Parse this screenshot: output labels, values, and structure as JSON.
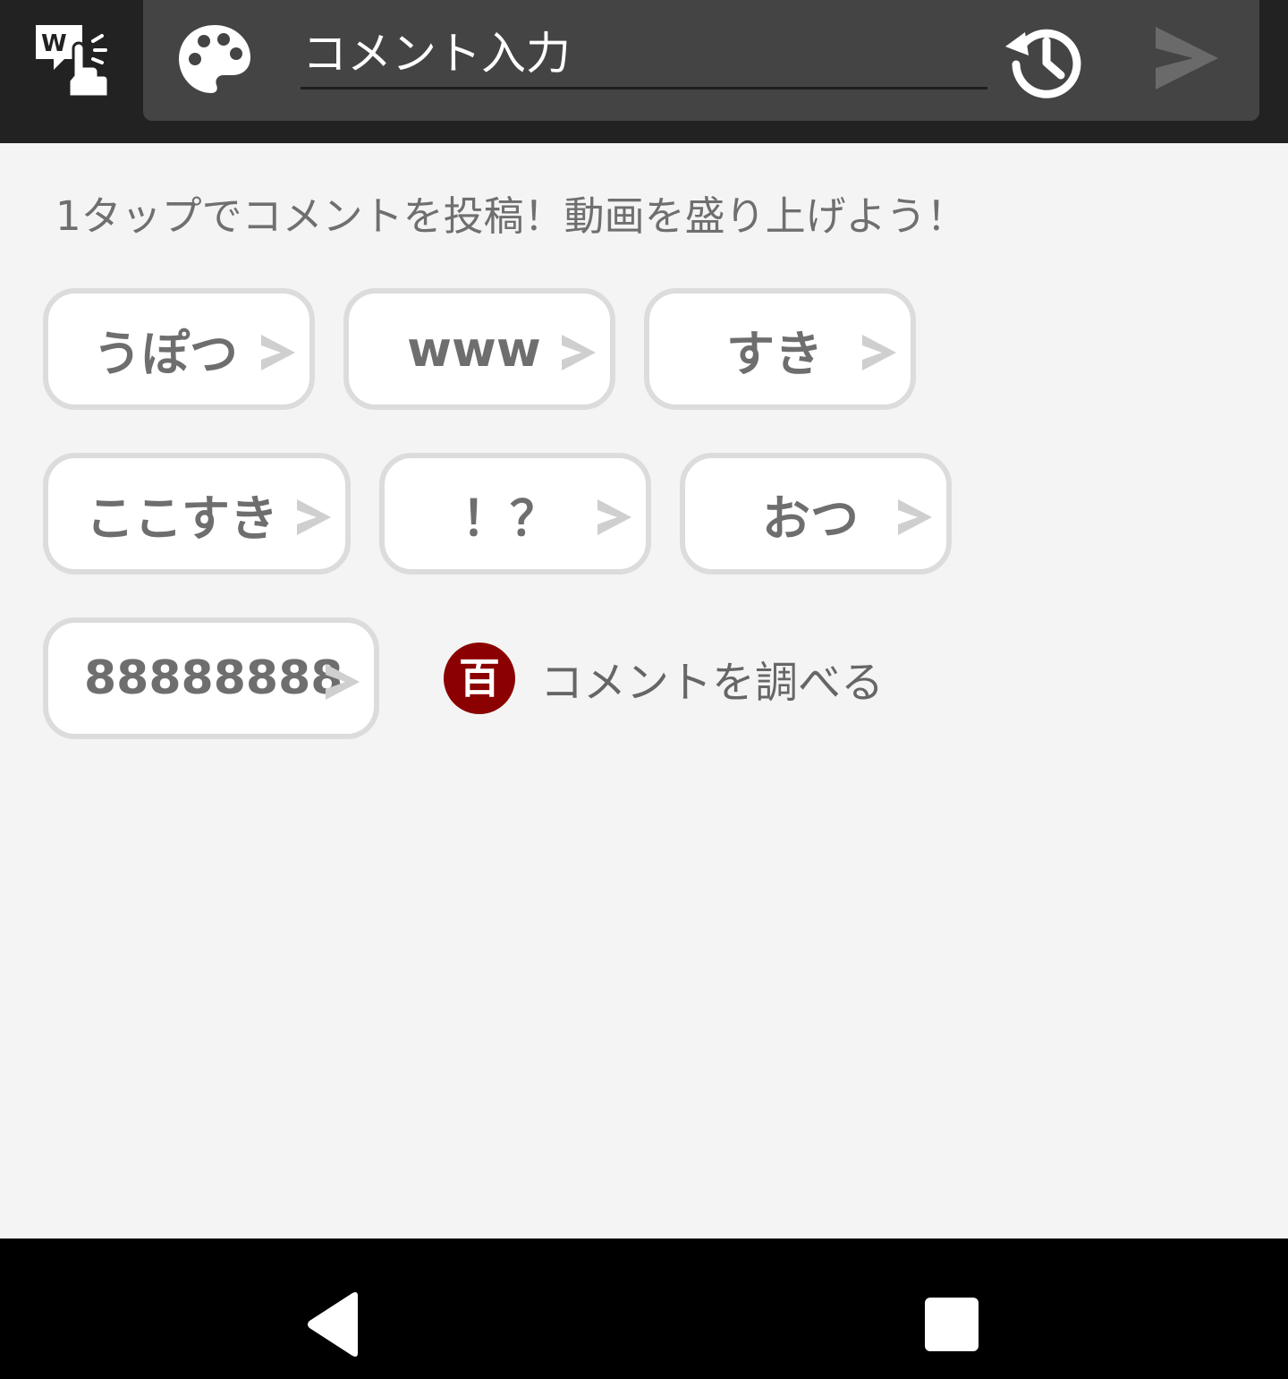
{
  "toolbar": {
    "app_icon": "wapp-touch-icon",
    "palette_icon": "palette-icon",
    "comment_placeholder": "コメント入力",
    "history_icon": "history-icon",
    "send_icon": "send-icon"
  },
  "hint": "1タップでコメントを投稿！動画を盛り上げよう！",
  "chips": [
    {
      "label": "うぽつ"
    },
    {
      "label": "www"
    },
    {
      "label": "すき"
    },
    {
      "label": "ここすき"
    },
    {
      "label": "！？"
    },
    {
      "label": "おつ"
    },
    {
      "label": "88888888"
    }
  ],
  "reference": {
    "badge": "百",
    "label": "コメントを調べる",
    "badge_color": "#8b0000"
  },
  "navbar": {
    "back_icon": "back-triangle-icon",
    "recents_icon": "recents-square-icon"
  },
  "colors": {
    "toolbar_bg": "#222222",
    "input_panel_bg": "#444444",
    "chip_border": "#dcdcdc",
    "chip_text": "#6e6e6e"
  }
}
